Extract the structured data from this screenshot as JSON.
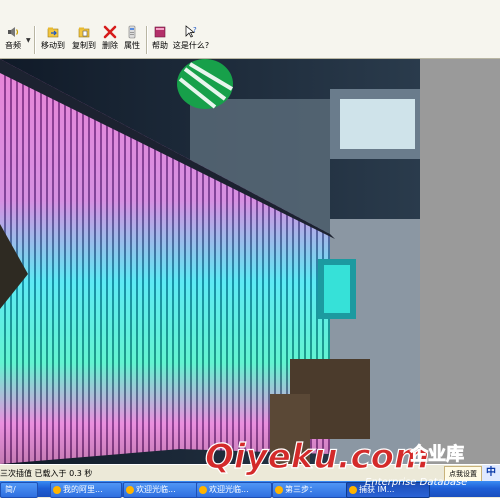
{
  "toolbar": {
    "audio_label": "音频",
    "move_to_label": "移动到",
    "copy_to_label": "复制到",
    "delete_label": "删除",
    "properties_label": "属性",
    "help_label": "帮助",
    "whats_this_label": "这是什么?"
  },
  "statusbar": {
    "text": "三次插值  已载入于 0.3 秒",
    "right_text": "点我设置",
    "ime_label": "中"
  },
  "taskbar": {
    "items": [
      {
        "label": "简/"
      },
      {
        "label": "我的阿里..."
      },
      {
        "label": "欢迎光临..."
      },
      {
        "label": "欢迎光临..."
      },
      {
        "label": "第三步："
      },
      {
        "label": "捕获 IM..."
      }
    ]
  },
  "watermark": {
    "brand": "Qiyeku.com",
    "brand_cn": "企业库",
    "tagline": "Enterprise Database"
  },
  "colors": {
    "toolbar_bg": "#f6f5ee",
    "side_pane": "#9a9a9a",
    "taskbar_blue": "#1e5fd6",
    "led_cyan": "#27e2f0",
    "led_magenta": "#e25cc9",
    "led_green": "#2ef08a",
    "watermark_red": "#d42a2a"
  }
}
